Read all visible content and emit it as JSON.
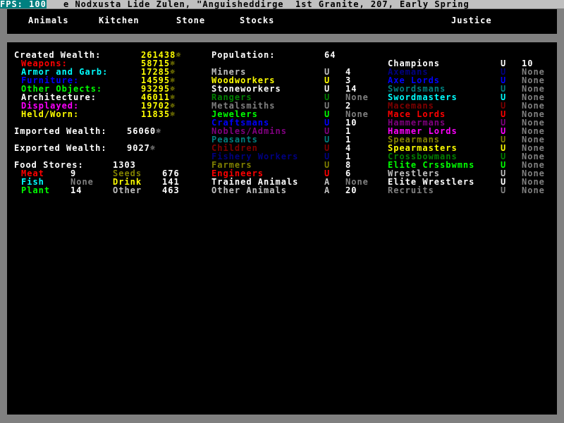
{
  "header": {
    "fps": "FPS: 100",
    "title": "e Nodxusta Lide Zulen, \"Anguisheddirge  1st Granite, 207, Early Spring"
  },
  "tabs": [
    "Animals",
    "Kitchen",
    "Stone",
    "Stocks",
    "Justice"
  ],
  "wealth": {
    "created_label": "Created Wealth:",
    "created_value": "261438☼",
    "items": [
      {
        "label": "Weapons:",
        "value": "58715☼",
        "color": "#ff0000"
      },
      {
        "label": "Armor and Garb:",
        "value": "17285☼",
        "color": "#00ffff"
      },
      {
        "label": "Furniture:",
        "value": "14595☼",
        "color": "#0000ff"
      },
      {
        "label": "Other Objects:",
        "value": "93295☼",
        "color": "#00ff00"
      },
      {
        "label": "Architecture:",
        "value": "46011☼",
        "color": "#ffffff"
      },
      {
        "label": "Displayed:",
        "value": "19702☼",
        "color": "#ff00ff"
      },
      {
        "label": "Held/Worn:",
        "value": "11835☼",
        "color": "#ffff00"
      }
    ],
    "imported_label": "Imported Wealth:",
    "imported_value": "56060☼",
    "exported_label": "Exported Wealth:",
    "exported_value": "9027☼"
  },
  "food": {
    "label": "Food Stores:",
    "total": "1303",
    "meat_label": "Meat",
    "meat": "9",
    "seeds_label": "Seeds",
    "seeds": "676",
    "fish_label": "Fish",
    "fish": "None",
    "drink_label": "Drink",
    "drink": "141",
    "plant_label": "Plant",
    "plant": "14",
    "other_label": "Other",
    "other": "463"
  },
  "population": {
    "label": "Population:",
    "value": "64",
    "rows": [
      {
        "name": "Miners",
        "mark": "U",
        "count": "4",
        "color": "#c0c0c0",
        "mark_color": "#c0c0c0",
        "count_color": "#ffffff"
      },
      {
        "name": "Woodworkers",
        "mark": "U",
        "count": "3",
        "color": "#ffff00",
        "mark_color": "#ffff00",
        "count_color": "#ffffff"
      },
      {
        "name": "Stoneworkers",
        "mark": "U",
        "count": "14",
        "color": "#ffffff",
        "mark_color": "#ffffff",
        "count_color": "#ffffff"
      },
      {
        "name": "Rangers",
        "mark": "U",
        "count": "None",
        "color": "#008000",
        "mark_color": "#008000",
        "count_color": "#808080"
      },
      {
        "name": "Metalsmiths",
        "mark": "U",
        "count": "2",
        "color": "#808080",
        "mark_color": "#808080",
        "count_color": "#ffffff"
      },
      {
        "name": "Jewelers",
        "mark": "U",
        "count": "None",
        "color": "#00ff00",
        "mark_color": "#00ff00",
        "count_color": "#808080"
      },
      {
        "name": "Craftsmans",
        "mark": "U",
        "count": "10",
        "color": "#0000ff",
        "mark_color": "#0000ff",
        "count_color": "#ffffff"
      },
      {
        "name": "Nobles/Admins",
        "mark": "U",
        "count": "1",
        "color": "#800080",
        "mark_color": "#800080",
        "count_color": "#ffffff"
      },
      {
        "name": "Peasants",
        "mark": "U",
        "count": "1",
        "color": "#008080",
        "mark_color": "#008080",
        "count_color": "#ffffff"
      },
      {
        "name": "Children",
        "mark": "U",
        "count": "4",
        "color": "#800000",
        "mark_color": "#800000",
        "count_color": "#ffffff"
      },
      {
        "name": "Fishery Workers",
        "mark": "U",
        "count": "1",
        "color": "#000080",
        "mark_color": "#000080",
        "count_color": "#ffffff"
      },
      {
        "name": "Farmers",
        "mark": "U",
        "count": "8",
        "color": "#808000",
        "mark_color": "#808000",
        "count_color": "#ffffff"
      },
      {
        "name": "Engineers",
        "mark": "U",
        "count": "6",
        "color": "#ff0000",
        "mark_color": "#ff0000",
        "count_color": "#ffffff"
      },
      {
        "name": "Trained Animals",
        "mark": "A",
        "count": "None",
        "color": "#ffffff",
        "mark_color": "#c0c0c0",
        "count_color": "#808080"
      },
      {
        "name": "Other Animals",
        "mark": "A",
        "count": "20",
        "color": "#c0c0c0",
        "mark_color": "#c0c0c0",
        "count_color": "#ffffff"
      }
    ]
  },
  "military": {
    "rows": [
      {
        "name": "Champions",
        "mark": "U",
        "count": "10",
        "color": "#ffffff",
        "mark_color": "#ffffff",
        "count_color": "#ffffff"
      },
      {
        "name": "Axemans",
        "mark": "U",
        "count": "None",
        "color": "#000080",
        "mark_color": "#000080",
        "count_color": "#808080"
      },
      {
        "name": "Axe Lords",
        "mark": "U",
        "count": "None",
        "color": "#0000ff",
        "mark_color": "#0000ff",
        "count_color": "#808080"
      },
      {
        "name": "Swordsmans",
        "mark": "U",
        "count": "None",
        "color": "#008080",
        "mark_color": "#008080",
        "count_color": "#808080"
      },
      {
        "name": "Swordmasters",
        "mark": "U",
        "count": "None",
        "color": "#00ffff",
        "mark_color": "#00ffff",
        "count_color": "#808080"
      },
      {
        "name": "Macemans",
        "mark": "U",
        "count": "None",
        "color": "#800000",
        "mark_color": "#800000",
        "count_color": "#808080"
      },
      {
        "name": "Mace Lords",
        "mark": "U",
        "count": "None",
        "color": "#ff0000",
        "mark_color": "#ff0000",
        "count_color": "#808080"
      },
      {
        "name": "Hammermans",
        "mark": "U",
        "count": "None",
        "color": "#800080",
        "mark_color": "#800080",
        "count_color": "#808080"
      },
      {
        "name": "Hammer Lords",
        "mark": "U",
        "count": "None",
        "color": "#ff00ff",
        "mark_color": "#ff00ff",
        "count_color": "#808080"
      },
      {
        "name": "Spearmans",
        "mark": "U",
        "count": "None",
        "color": "#808000",
        "mark_color": "#808000",
        "count_color": "#808080"
      },
      {
        "name": "Spearmasters",
        "mark": "U",
        "count": "None",
        "color": "#ffff00",
        "mark_color": "#ffff00",
        "count_color": "#808080"
      },
      {
        "name": "Crossbowmans",
        "mark": "U",
        "count": "None",
        "color": "#008000",
        "mark_color": "#008000",
        "count_color": "#808080"
      },
      {
        "name": "Elite Crssbwmns",
        "mark": "U",
        "count": "None",
        "color": "#00ff00",
        "mark_color": "#00ff00",
        "count_color": "#808080"
      },
      {
        "name": "Wrestlers",
        "mark": "U",
        "count": "None",
        "color": "#c0c0c0",
        "mark_color": "#c0c0c0",
        "count_color": "#808080"
      },
      {
        "name": "Elite Wrestlers",
        "mark": "U",
        "count": "None",
        "color": "#ffffff",
        "mark_color": "#ffffff",
        "count_color": "#808080"
      },
      {
        "name": "Recruits",
        "mark": "U",
        "count": "None",
        "color": "#808080",
        "mark_color": "#808080",
        "count_color": "#808080"
      }
    ]
  }
}
